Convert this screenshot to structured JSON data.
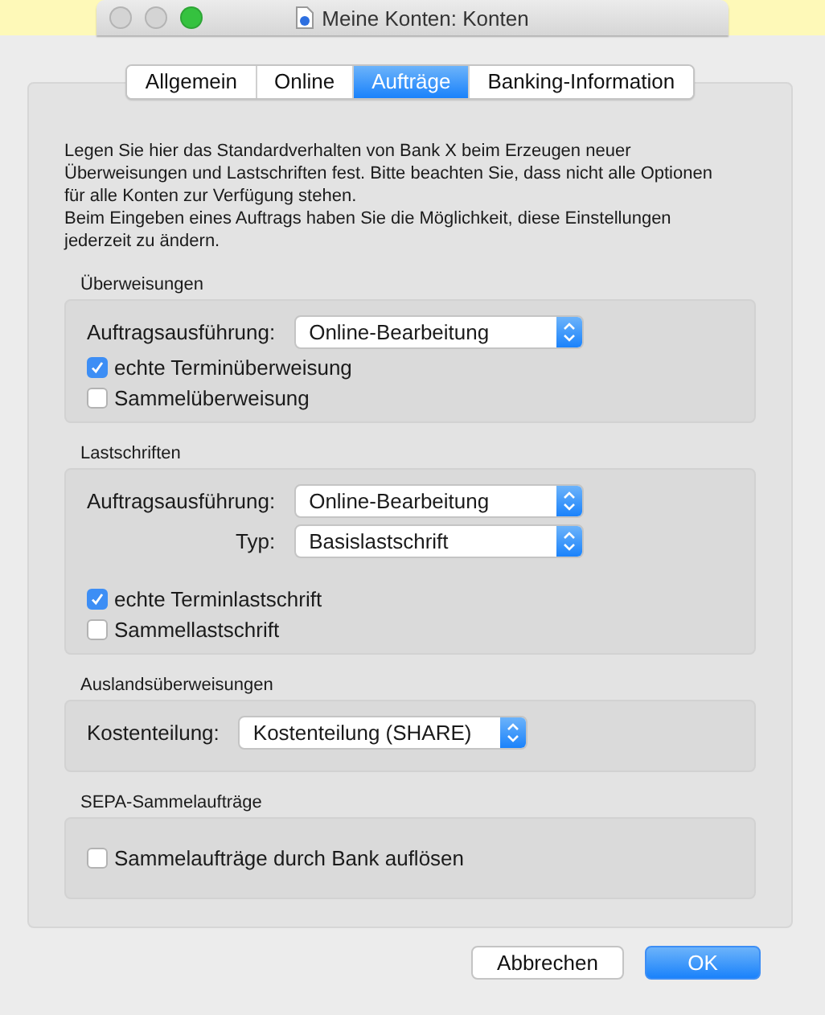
{
  "window": {
    "title": "Meine Konten: Konten"
  },
  "tabs": [
    {
      "label": "Allgemein",
      "selected": false
    },
    {
      "label": "Online",
      "selected": false
    },
    {
      "label": "Aufträge",
      "selected": true
    },
    {
      "label": "Banking-Information",
      "selected": false
    }
  ],
  "intro": [
    "Legen Sie hier das Standardverhalten von Bank X beim Erzeugen neuer Überweisungen und Lastschriften fest. Bitte beachten Sie, dass nicht alle Optionen für alle Konten zur Verfügung stehen.",
    "Beim Eingeben eines Auftrags haben Sie die Möglichkeit, diese Einstellungen jederzeit zu ändern."
  ],
  "sections": [
    {
      "title": "Überweisungen",
      "items": [
        {
          "kind": "select",
          "label": "Auftragsausführung:",
          "value": "Online-Bearbeitung"
        },
        {
          "kind": "checkbox",
          "label": "echte Terminüberweisung",
          "checked": true
        },
        {
          "kind": "checkbox",
          "label": "Sammelüberweisung",
          "checked": false
        }
      ]
    },
    {
      "title": "Lastschriften",
      "items": [
        {
          "kind": "select",
          "label": "Auftragsausführung:",
          "value": "Online-Bearbeitung"
        },
        {
          "kind": "select",
          "label": "Typ:",
          "value": "Basislastschrift"
        },
        {
          "kind": "checkbox",
          "label": "echte Terminlastschrift",
          "checked": true
        },
        {
          "kind": "checkbox",
          "label": "Sammellastschrift",
          "checked": false
        }
      ]
    },
    {
      "title": "Auslandsüberweisungen",
      "items": [
        {
          "kind": "select",
          "label": "Kostenteilung:",
          "value": "Kostenteilung (SHARE)"
        }
      ]
    },
    {
      "title": "SEPA-Sammelaufträge",
      "items": [
        {
          "kind": "checkbox",
          "label": "Sammelaufträge durch Bank auflösen",
          "checked": false
        }
      ]
    }
  ],
  "buttons": [
    {
      "label": "Abbrechen",
      "kind": "secondary"
    },
    {
      "label": "OK",
      "kind": "primary"
    }
  ]
}
